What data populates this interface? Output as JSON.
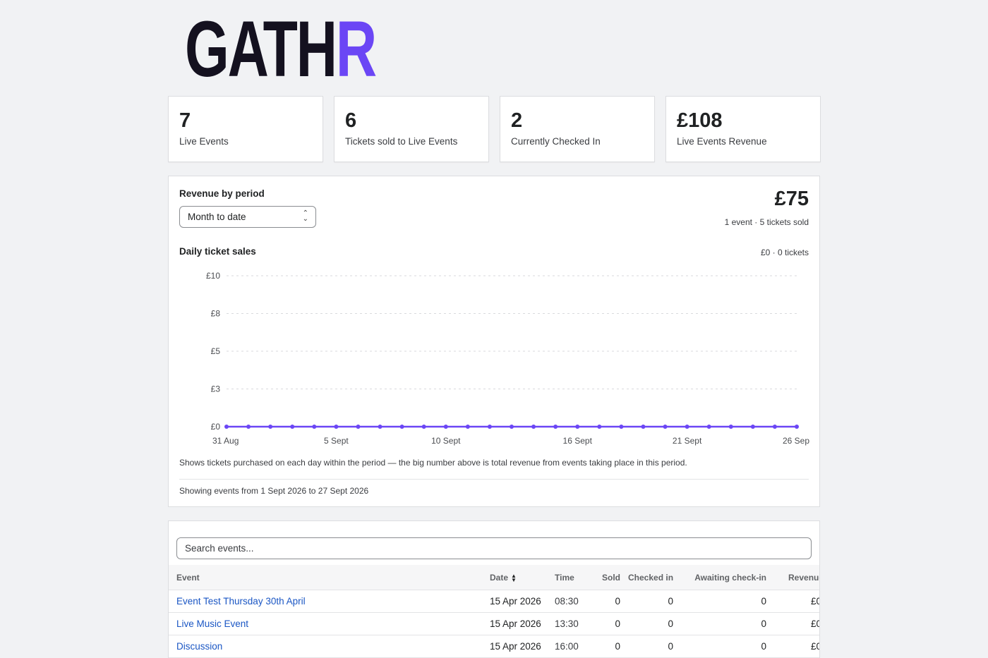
{
  "brand": {
    "logo_main": "GATH",
    "logo_accent": "R",
    "accent_color": "#6b46f5"
  },
  "stats": [
    {
      "value": "7",
      "label": "Live Events"
    },
    {
      "value": "6",
      "label": "Tickets sold to Live Events"
    },
    {
      "value": "2",
      "label": "Currently Checked In"
    },
    {
      "value": "£108",
      "label": "Live Events Revenue"
    }
  ],
  "revenue": {
    "title": "Revenue by period",
    "period_selected": "Month to date",
    "total": "£75",
    "summary": "1 event · 5 tickets sold",
    "daily_title": "Daily ticket sales",
    "daily_summary": "£0 · 0 tickets",
    "note": "Shows tickets purchased on each day within the period — the big number above is total revenue from events taking place in this period.",
    "range": "Showing events from 1 Sept 2026 to 27 Sept 2026"
  },
  "chart_data": {
    "type": "line",
    "color": "#6b46f5",
    "ylim": [
      0,
      10
    ],
    "yticks": [
      {
        "value": 0,
        "label": "£0"
      },
      {
        "value": 2.5,
        "label": "£3"
      },
      {
        "value": 5,
        "label": "£5"
      },
      {
        "value": 7.5,
        "label": "£8"
      },
      {
        "value": 10,
        "label": "£10"
      }
    ],
    "xticks": [
      {
        "index": 0,
        "label": "31 Aug"
      },
      {
        "index": 5,
        "label": "5 Sept"
      },
      {
        "index": 10,
        "label": "10 Sept"
      },
      {
        "index": 16,
        "label": "16 Sept"
      },
      {
        "index": 21,
        "label": "21 Sept"
      },
      {
        "index": 26,
        "label": "26 Sep"
      }
    ],
    "x": [
      "31 Aug",
      "1 Sept",
      "2 Sept",
      "3 Sept",
      "4 Sept",
      "5 Sept",
      "6 Sept",
      "7 Sept",
      "8 Sept",
      "9 Sept",
      "10 Sept",
      "11 Sept",
      "12 Sept",
      "13 Sept",
      "14 Sept",
      "15 Sept",
      "16 Sept",
      "17 Sept",
      "18 Sept",
      "19 Sept",
      "20 Sept",
      "21 Sept",
      "22 Sept",
      "23 Sept",
      "24 Sept",
      "25 Sept",
      "26 Sept"
    ],
    "values": [
      0,
      0,
      0,
      0,
      0,
      0,
      0,
      0,
      0,
      0,
      0,
      0,
      0,
      0,
      0,
      0,
      0,
      0,
      0,
      0,
      0,
      0,
      0,
      0,
      0,
      0,
      0
    ],
    "grid": true
  },
  "events": {
    "search_placeholder": "Search events...",
    "columns": {
      "event": "Event",
      "date": "Date",
      "time": "Time",
      "sold": "Sold",
      "checked_in": "Checked in",
      "awaiting": "Awaiting check-in",
      "revenue": "Revenue"
    },
    "rows": [
      {
        "name": "Event Test Thursday 30th April",
        "date": "15 Apr 2026",
        "time": "08:30",
        "sold": "0",
        "checked_in": "0",
        "awaiting": "0",
        "revenue": "£0"
      },
      {
        "name": "Live Music Event",
        "date": "15 Apr 2026",
        "time": "13:30",
        "sold": "0",
        "checked_in": "0",
        "awaiting": "0",
        "revenue": "£0"
      },
      {
        "name": "Discussion",
        "date": "15 Apr 2026",
        "time": "16:00",
        "sold": "0",
        "checked_in": "0",
        "awaiting": "0",
        "revenue": "£0"
      }
    ]
  }
}
